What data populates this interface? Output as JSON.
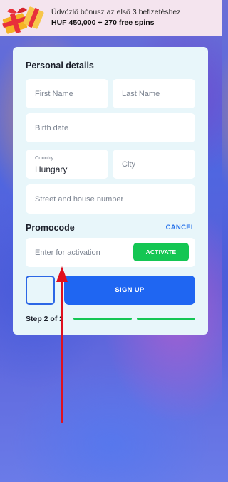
{
  "banner": {
    "line1": "Üdvözlő bónusz az első 3 befizetéshez",
    "line2": "HUF 450,000 + 270 free spins"
  },
  "form": {
    "section_personal": "Personal details",
    "first_name_placeholder": "First Name",
    "last_name_placeholder": "Last Name",
    "birth_date_placeholder": "Birth date",
    "country_label": "Country",
    "country_value": "Hungary",
    "city_placeholder": "City",
    "street_placeholder": "Street and house number",
    "section_promocode": "Promocode",
    "cancel_label": "CANCEL",
    "promo_placeholder": "Enter for activation",
    "activate_label": "ACTIVATE",
    "signup_label": "SIGN UP",
    "step_text": "Step 2 of 2",
    "progress": {
      "current": 2,
      "total": 2
    }
  },
  "colors": {
    "accent_blue": "#1f66f2",
    "accent_green": "#14c653",
    "annotation_red": "#e0101e"
  },
  "icons": {
    "banner": "gift-icon",
    "annotation": "arrow-up-icon"
  }
}
